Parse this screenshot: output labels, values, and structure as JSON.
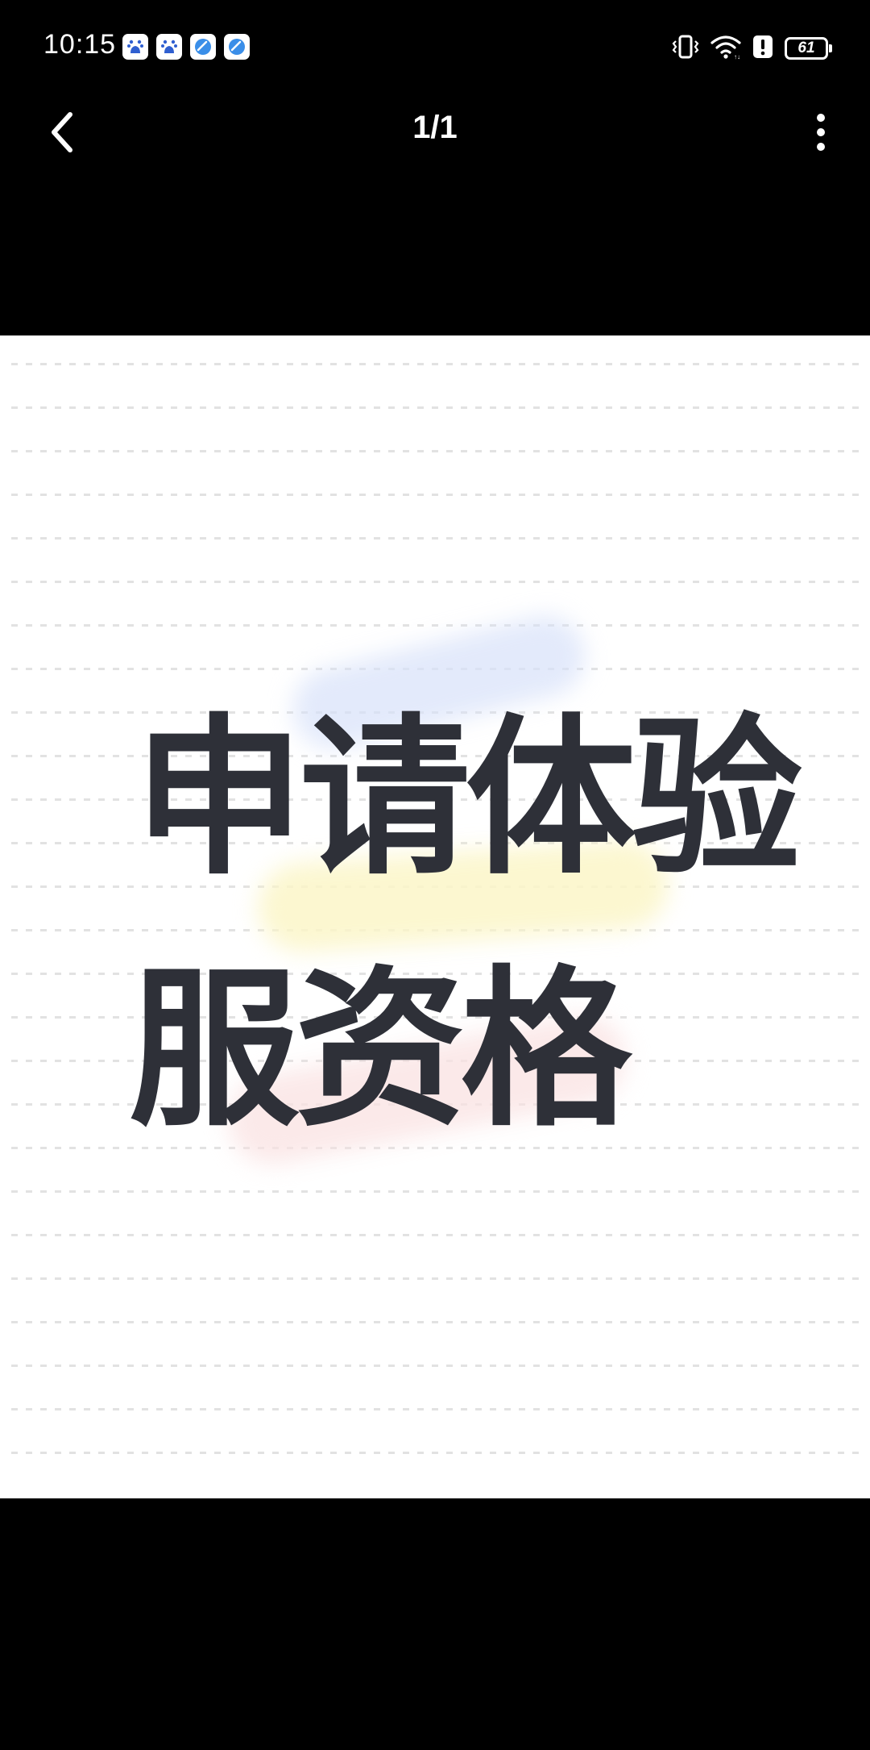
{
  "status_bar": {
    "time": "10:15",
    "notification_icons": [
      "baidu-app-icon",
      "baidu-app-icon",
      "blue-app-icon",
      "blue-app-icon"
    ],
    "battery_level": "61",
    "system_icons": [
      "vibrate-icon",
      "wifi-icon",
      "alert-icon",
      "battery-icon"
    ]
  },
  "viewer": {
    "page_counter": "1/1",
    "back_icon": "chevron-left-icon",
    "more_icon": "more-vertical-icon"
  },
  "image": {
    "line1": "申请体验",
    "line2": "服资格"
  },
  "colors": {
    "background": "#000000",
    "image_background": "#ffffff",
    "text": "#2e3038"
  }
}
